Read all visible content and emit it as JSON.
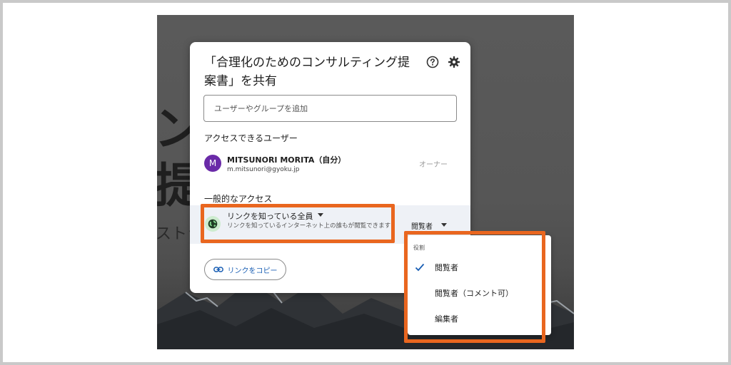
{
  "background": {
    "line1": "ンフ",
    "line2": "提案",
    "line3": "ストラ"
  },
  "dialog": {
    "title": "「合理化のためのコンサルティング提案書」を共有",
    "help_icon": "help-circle-icon",
    "settings_icon": "gear-icon",
    "input_placeholder": "ユーザーやグループを追加",
    "access_heading": "アクセスできるユーザー",
    "user": {
      "avatar_letter": "M",
      "name": "MITSUNORI MORITA（自分）",
      "email": "m.mitsunori@gyoku.jp",
      "role": "オーナー"
    },
    "general_heading": "一般的なアクセス",
    "general_access": {
      "scope": "リンクを知っている全員",
      "description": "リンクを知っているインターネット上の誰もが閲覧できます",
      "role": "閲覧者"
    },
    "copy_link_label": "リンクをコピー"
  },
  "role_menu": {
    "heading": "役割",
    "items": [
      {
        "label": "閲覧者",
        "selected": true
      },
      {
        "label": "閲覧者（コメント可）",
        "selected": false
      },
      {
        "label": "編集者",
        "selected": false
      }
    ]
  },
  "colors": {
    "highlight": "#e9661f",
    "avatar": "#6a2aa8",
    "link_blue": "#1a5fb4"
  }
}
